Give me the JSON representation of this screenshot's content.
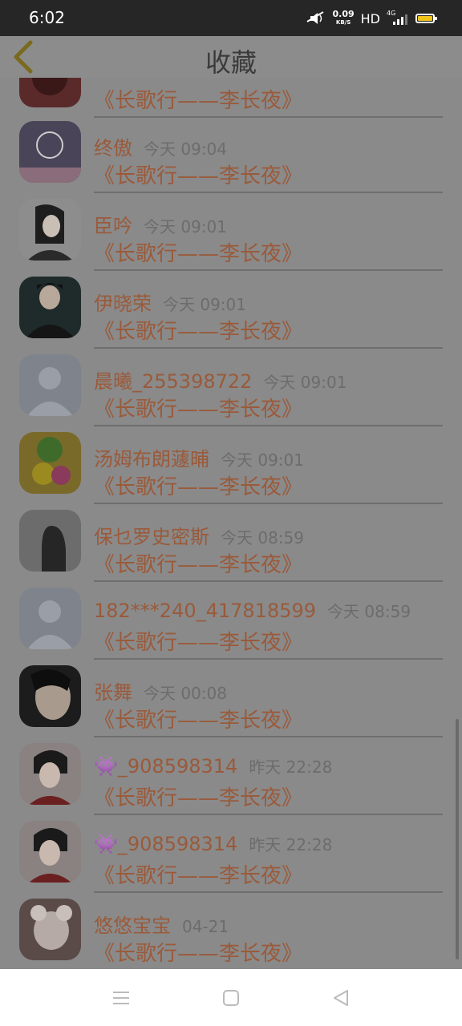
{
  "status": {
    "time": "6:02",
    "speed": "0.09",
    "speed_unit": "KB/S",
    "hd": "HD",
    "network": "4G"
  },
  "header": {
    "title": "收藏"
  },
  "items": [
    {
      "name": "",
      "time": "",
      "book": "《长歌行——李长夜》"
    },
    {
      "name": "终傲",
      "time": "今天 09:04",
      "book": "《长歌行——李长夜》"
    },
    {
      "name": "臣吟",
      "time": "今天 09:01",
      "book": "《长歌行——李长夜》"
    },
    {
      "name": "伊晓荣",
      "time": "今天 09:01",
      "book": "《长歌行——李长夜》"
    },
    {
      "name": "晨曦_255398722",
      "time": "今天 09:01",
      "book": "《长歌行——李长夜》"
    },
    {
      "name": "汤姆布朗蘧晡",
      "time": "今天 09:01",
      "book": "《长歌行——李长夜》"
    },
    {
      "name": "保乜罗史密斯",
      "time": "今天 08:59",
      "book": "《长歌行——李长夜》"
    },
    {
      "name": "182***240_417818599",
      "time": "今天 08:59",
      "book": "《长歌行——李长夜》"
    },
    {
      "name": "张舞",
      "time": "今天 00:08",
      "book": "《长歌行——李长夜》"
    },
    {
      "name": "👾_908598314",
      "time": "昨天 22:28",
      "book": "《长歌行——李长夜》"
    },
    {
      "name": "👾_908598314",
      "time": "昨天 22:28",
      "book": "《长歌行——李长夜》"
    },
    {
      "name": "悠悠宝宝",
      "time": "04-21",
      "book": "《长歌行——李长夜》"
    }
  ],
  "colors": {
    "name_accent": "#9a5a3a",
    "back_arrow": "#7a6a1e",
    "overlay": "#8a8a8a"
  }
}
